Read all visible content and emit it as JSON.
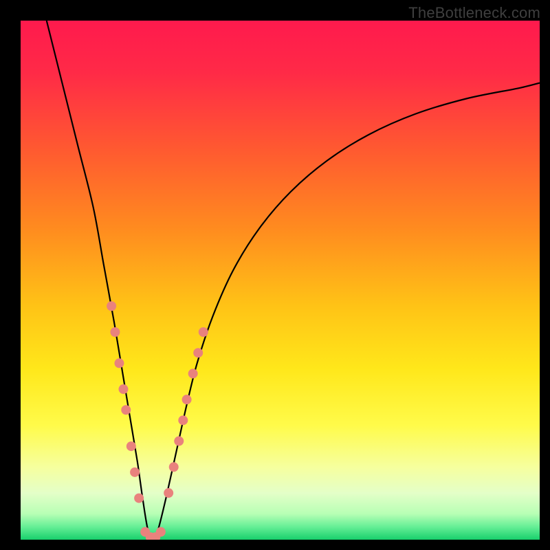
{
  "watermark": "TheBottleneck.com",
  "chart_data": {
    "type": "line",
    "title": "",
    "xlabel": "",
    "ylabel": "",
    "xlim": [
      0,
      100
    ],
    "ylim": [
      0,
      100
    ],
    "grid": false,
    "legend": false,
    "background_gradient": {
      "stops": [
        {
          "offset": 0.0,
          "color": "#ff1a4d"
        },
        {
          "offset": 0.1,
          "color": "#ff2a47"
        },
        {
          "offset": 0.25,
          "color": "#ff5a30"
        },
        {
          "offset": 0.4,
          "color": "#ff8b1f"
        },
        {
          "offset": 0.55,
          "color": "#ffc316"
        },
        {
          "offset": 0.67,
          "color": "#ffe71a"
        },
        {
          "offset": 0.78,
          "color": "#fffb4a"
        },
        {
          "offset": 0.86,
          "color": "#f6ff9e"
        },
        {
          "offset": 0.91,
          "color": "#e4ffc8"
        },
        {
          "offset": 0.95,
          "color": "#b8ffb5"
        },
        {
          "offset": 0.975,
          "color": "#66ef96"
        },
        {
          "offset": 1.0,
          "color": "#18d06c"
        }
      ]
    },
    "series": [
      {
        "name": "bottleneck-curve",
        "color": "#000000",
        "x": [
          5,
          8,
          11,
          14,
          16,
          18,
          19.5,
          21,
          22.5,
          23.5,
          24.5,
          25.5,
          26.5,
          28,
          30,
          32,
          34,
          37,
          41,
          46,
          52,
          59,
          67,
          76,
          86,
          96,
          100
        ],
        "y": [
          100,
          88,
          76,
          64,
          53,
          42,
          33,
          24,
          15,
          8,
          2,
          0,
          2,
          8,
          17,
          26,
          34,
          43,
          52,
          60,
          67,
          73,
          78,
          82,
          85,
          87,
          88
        ]
      }
    ],
    "markers": {
      "name": "highlight-dots",
      "color": "#e9827d",
      "radius": 7,
      "points": [
        {
          "x": 17.5,
          "y": 45
        },
        {
          "x": 18.2,
          "y": 40
        },
        {
          "x": 19.0,
          "y": 34
        },
        {
          "x": 19.8,
          "y": 29
        },
        {
          "x": 20.3,
          "y": 25
        },
        {
          "x": 21.3,
          "y": 18
        },
        {
          "x": 22.0,
          "y": 13
        },
        {
          "x": 22.8,
          "y": 8
        },
        {
          "x": 24.0,
          "y": 1.5
        },
        {
          "x": 25.0,
          "y": 0.5
        },
        {
          "x": 26.0,
          "y": 0.5
        },
        {
          "x": 27.0,
          "y": 1.5
        },
        {
          "x": 28.5,
          "y": 9
        },
        {
          "x": 29.5,
          "y": 14
        },
        {
          "x": 30.5,
          "y": 19
        },
        {
          "x": 31.3,
          "y": 23
        },
        {
          "x": 32.0,
          "y": 27
        },
        {
          "x": 33.2,
          "y": 32
        },
        {
          "x": 34.2,
          "y": 36
        },
        {
          "x": 35.2,
          "y": 40
        }
      ]
    }
  }
}
